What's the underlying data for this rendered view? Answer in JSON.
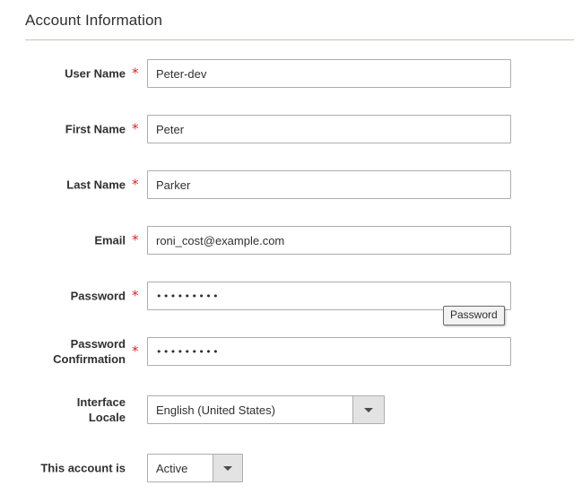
{
  "section": {
    "title": "Account Information"
  },
  "colors": {
    "required_asterisk": "#e22626",
    "label_text": "#303030",
    "input_border": "#adadad",
    "divider": "#cac3b4",
    "select_button_bg": "#e3e3e3",
    "tooltip_bg": "#f2f2f2",
    "tooltip_border": "#6e6e6e"
  },
  "fields": {
    "user_name": {
      "label": "User Name",
      "required_marker": "*",
      "value": "Peter-dev",
      "placeholder": ""
    },
    "first_name": {
      "label": "First Name",
      "required_marker": "*",
      "value": "Peter",
      "placeholder": ""
    },
    "last_name": {
      "label": "Last Name",
      "required_marker": "*",
      "value": "Parker",
      "placeholder": ""
    },
    "email": {
      "label": "Email",
      "required_marker": "*",
      "value": "roni_cost@example.com",
      "placeholder": ""
    },
    "password": {
      "label": "Password",
      "required_marker": "*",
      "value": "•••••••••",
      "placeholder": ""
    },
    "password_confirmation": {
      "label": "Password\nConfirmation",
      "required_marker": "*",
      "value": "•••••••••",
      "placeholder": ""
    },
    "interface_locale": {
      "label": "Interface\nLocale",
      "selected": "English (United States)",
      "caret_icon": "chevron-down-icon"
    },
    "account_status": {
      "label": "This account is",
      "selected": "Active",
      "caret_icon": "chevron-down-icon"
    }
  },
  "tooltip": {
    "text": "Password"
  }
}
